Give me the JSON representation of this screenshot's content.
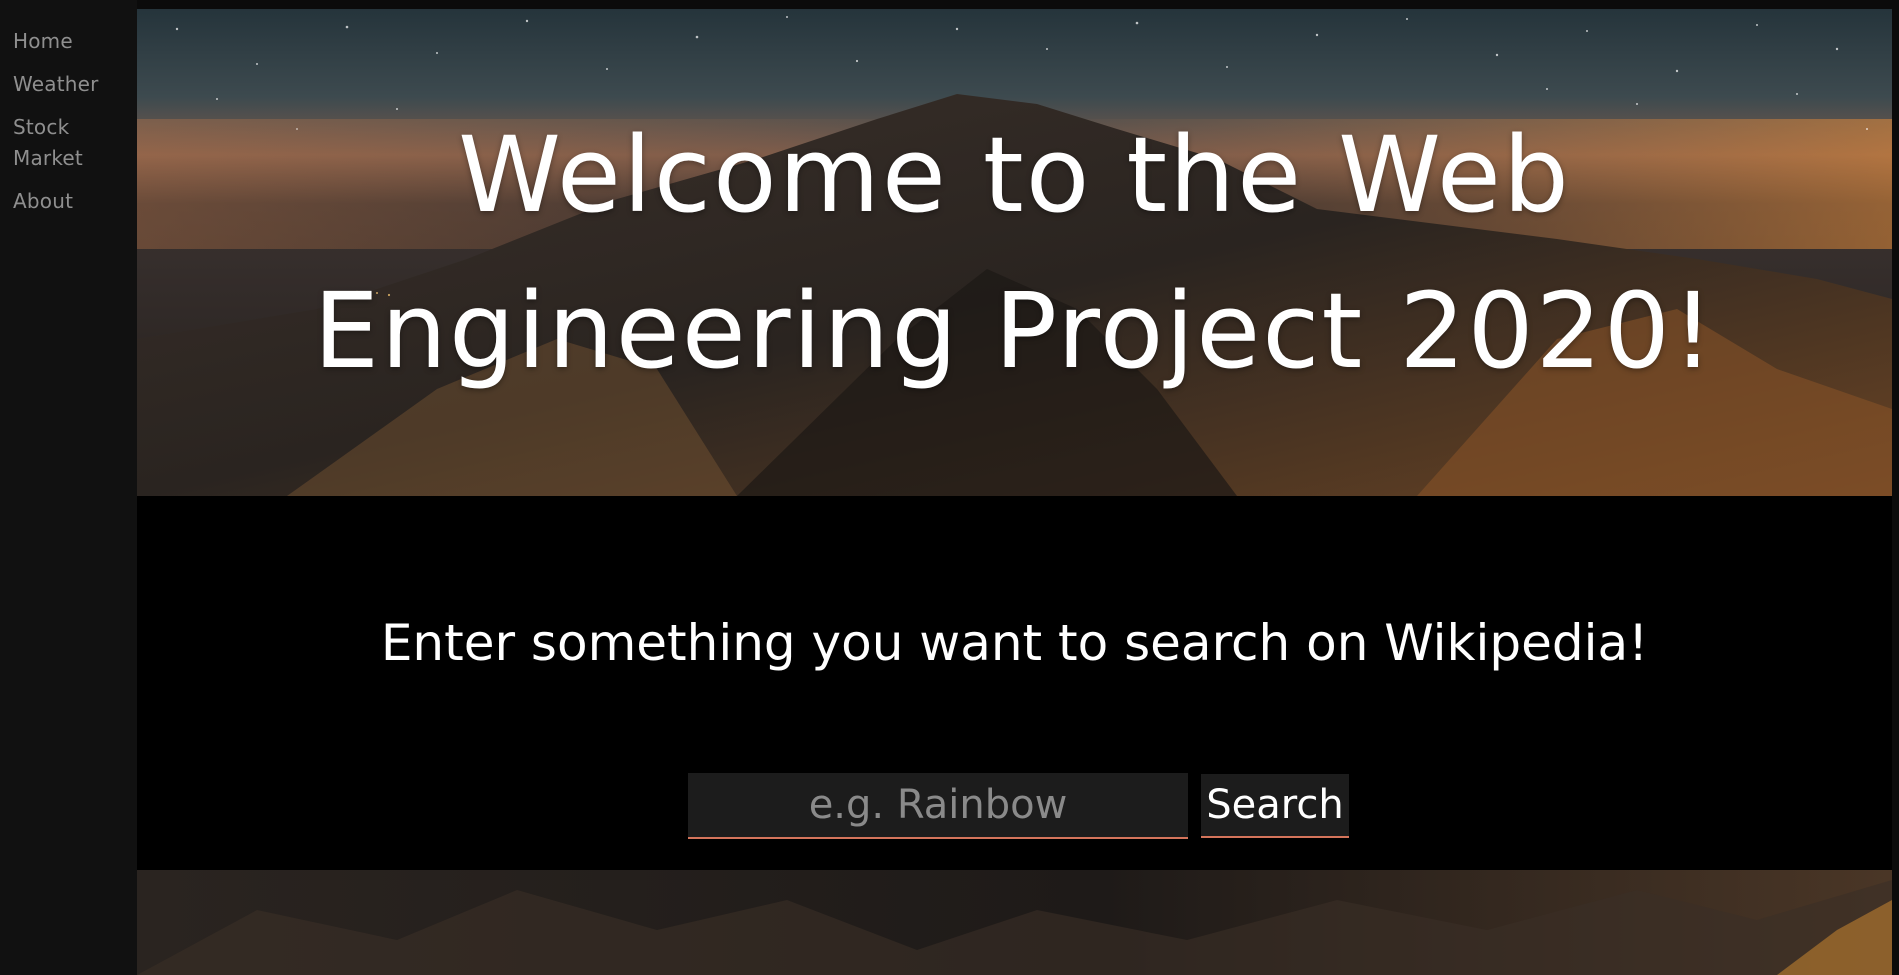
{
  "nav": {
    "items": [
      {
        "label": "Home"
      },
      {
        "label": "Weather"
      },
      {
        "label": "Stock Market"
      },
      {
        "label": "About"
      }
    ]
  },
  "hero": {
    "title": "Welcome to the Web Engineering Project 2020!"
  },
  "search": {
    "heading": "Enter something you want to search on Wikipedia!",
    "placeholder": "e.g. Rainbow",
    "value": "",
    "button_label": "Search"
  },
  "colors": {
    "sidebar_bg": "#111111",
    "section_bg": "#000000",
    "input_bg": "#1c1c1c",
    "accent_underline": "#d4745b",
    "nav_text": "#8f8f8f",
    "heading_text": "#ffffff"
  }
}
